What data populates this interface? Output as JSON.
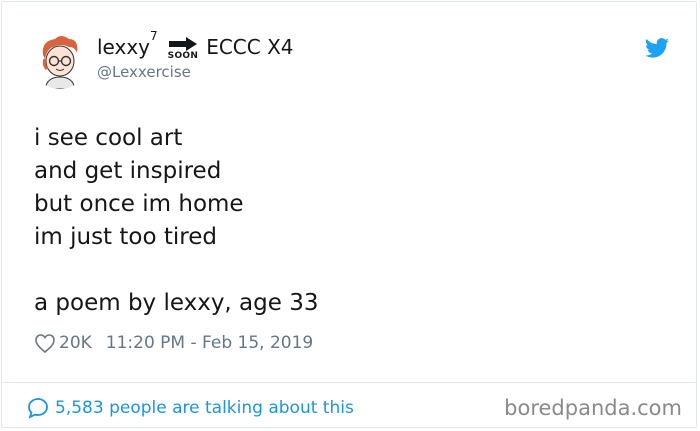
{
  "author": {
    "display_name": "lexxy",
    "name_superscript": "7",
    "badge_text": "SOON",
    "event_text": "ECCC X4",
    "handle": "@Lexxercise"
  },
  "tweet": {
    "text": "i see cool art\nand get inspired\nbut once im home\nim just too tired\n\na poem by lexxy, age 33",
    "likes": "20K",
    "timestamp": "11:20 PM - Feb 15, 2019"
  },
  "footer": {
    "talking": "5,583 people are talking about this",
    "watermark": "boredpanda.com"
  },
  "colors": {
    "twitter_blue": "#1da1f2",
    "link_blue": "#1b95e0",
    "muted": "#657786",
    "text": "#14171a"
  },
  "icons": {
    "avatar": "avatar-illustration",
    "twitter": "twitter-bird-icon",
    "likes": "heart-outline-icon",
    "talking": "speech-bubble-icon",
    "badge_arrow": "arrow-right-icon"
  }
}
